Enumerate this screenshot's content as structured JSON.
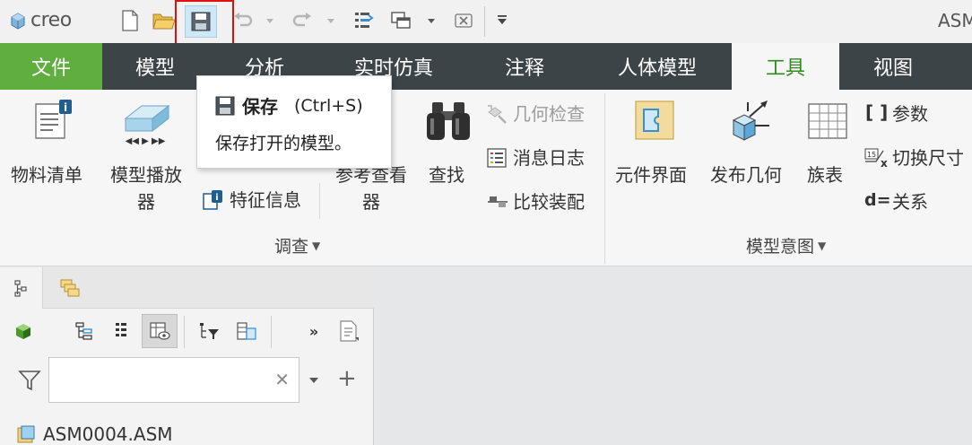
{
  "app": {
    "logo_text": "creo",
    "window_title": "ASM"
  },
  "quick_access": {
    "save_tooltip_visible": true
  },
  "tabs": [
    {
      "label": "文件"
    },
    {
      "label": "模型"
    },
    {
      "label": "分析"
    },
    {
      "label": "实时仿真"
    },
    {
      "label": "注释"
    },
    {
      "label": "人体模型"
    },
    {
      "label": "工具"
    },
    {
      "label": "视图"
    }
  ],
  "active_tab": "工具",
  "ribbon": {
    "investigate": {
      "bom": "物料清单",
      "model_player_l1": "模型播放",
      "model_player_l2": "器",
      "feature_info": "特征信息",
      "ref_viewer_l1": "参考查看",
      "ref_viewer_l2": "器",
      "find": "查找",
      "geometry_check": "几何检查",
      "message_log": "消息日志",
      "compare_assembly": "比较装配",
      "group_label": "调查"
    },
    "model_intent": {
      "component_interface": "元件界面",
      "publish_geometry": "发布几何",
      "family_table": "族表",
      "parameters": "参数",
      "switch_dimensions": "切换尺寸",
      "relations": "关系",
      "group_label": "模型意图"
    }
  },
  "tooltip": {
    "title": "保存",
    "shortcut": "(Ctrl+S)",
    "description": "保存打开的模型。"
  },
  "panel": {
    "search_value": "",
    "tree_root": "ASM0004.ASM"
  },
  "colors": {
    "file_tab": "#5fae3f",
    "tab_bar": "#3d4448",
    "active_tab_text": "#2f8a1f",
    "highlight_box": "#e01010"
  }
}
